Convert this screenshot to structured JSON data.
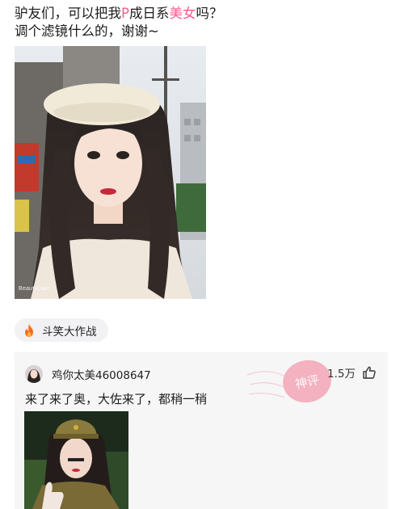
{
  "post": {
    "text_before": "驴友们，可以把我",
    "highlight_p": "P",
    "text_mid": "成日系",
    "highlight_girl": "美女",
    "text_end": "吗？",
    "line2": "调个滤镜什么的，谢谢~",
    "highlight_color": "#ff5a8c",
    "photo_watermark": "BeautyCam"
  },
  "topic": {
    "icon": "fire-icon",
    "label": "斗笑大作战"
  },
  "comment": {
    "username": "鸡你太美46008647",
    "like_count": "1.5万",
    "text": "来了来了奥，大佐来了，都稍一稍",
    "badge": "神评",
    "badge_color": "#f47a93"
  }
}
